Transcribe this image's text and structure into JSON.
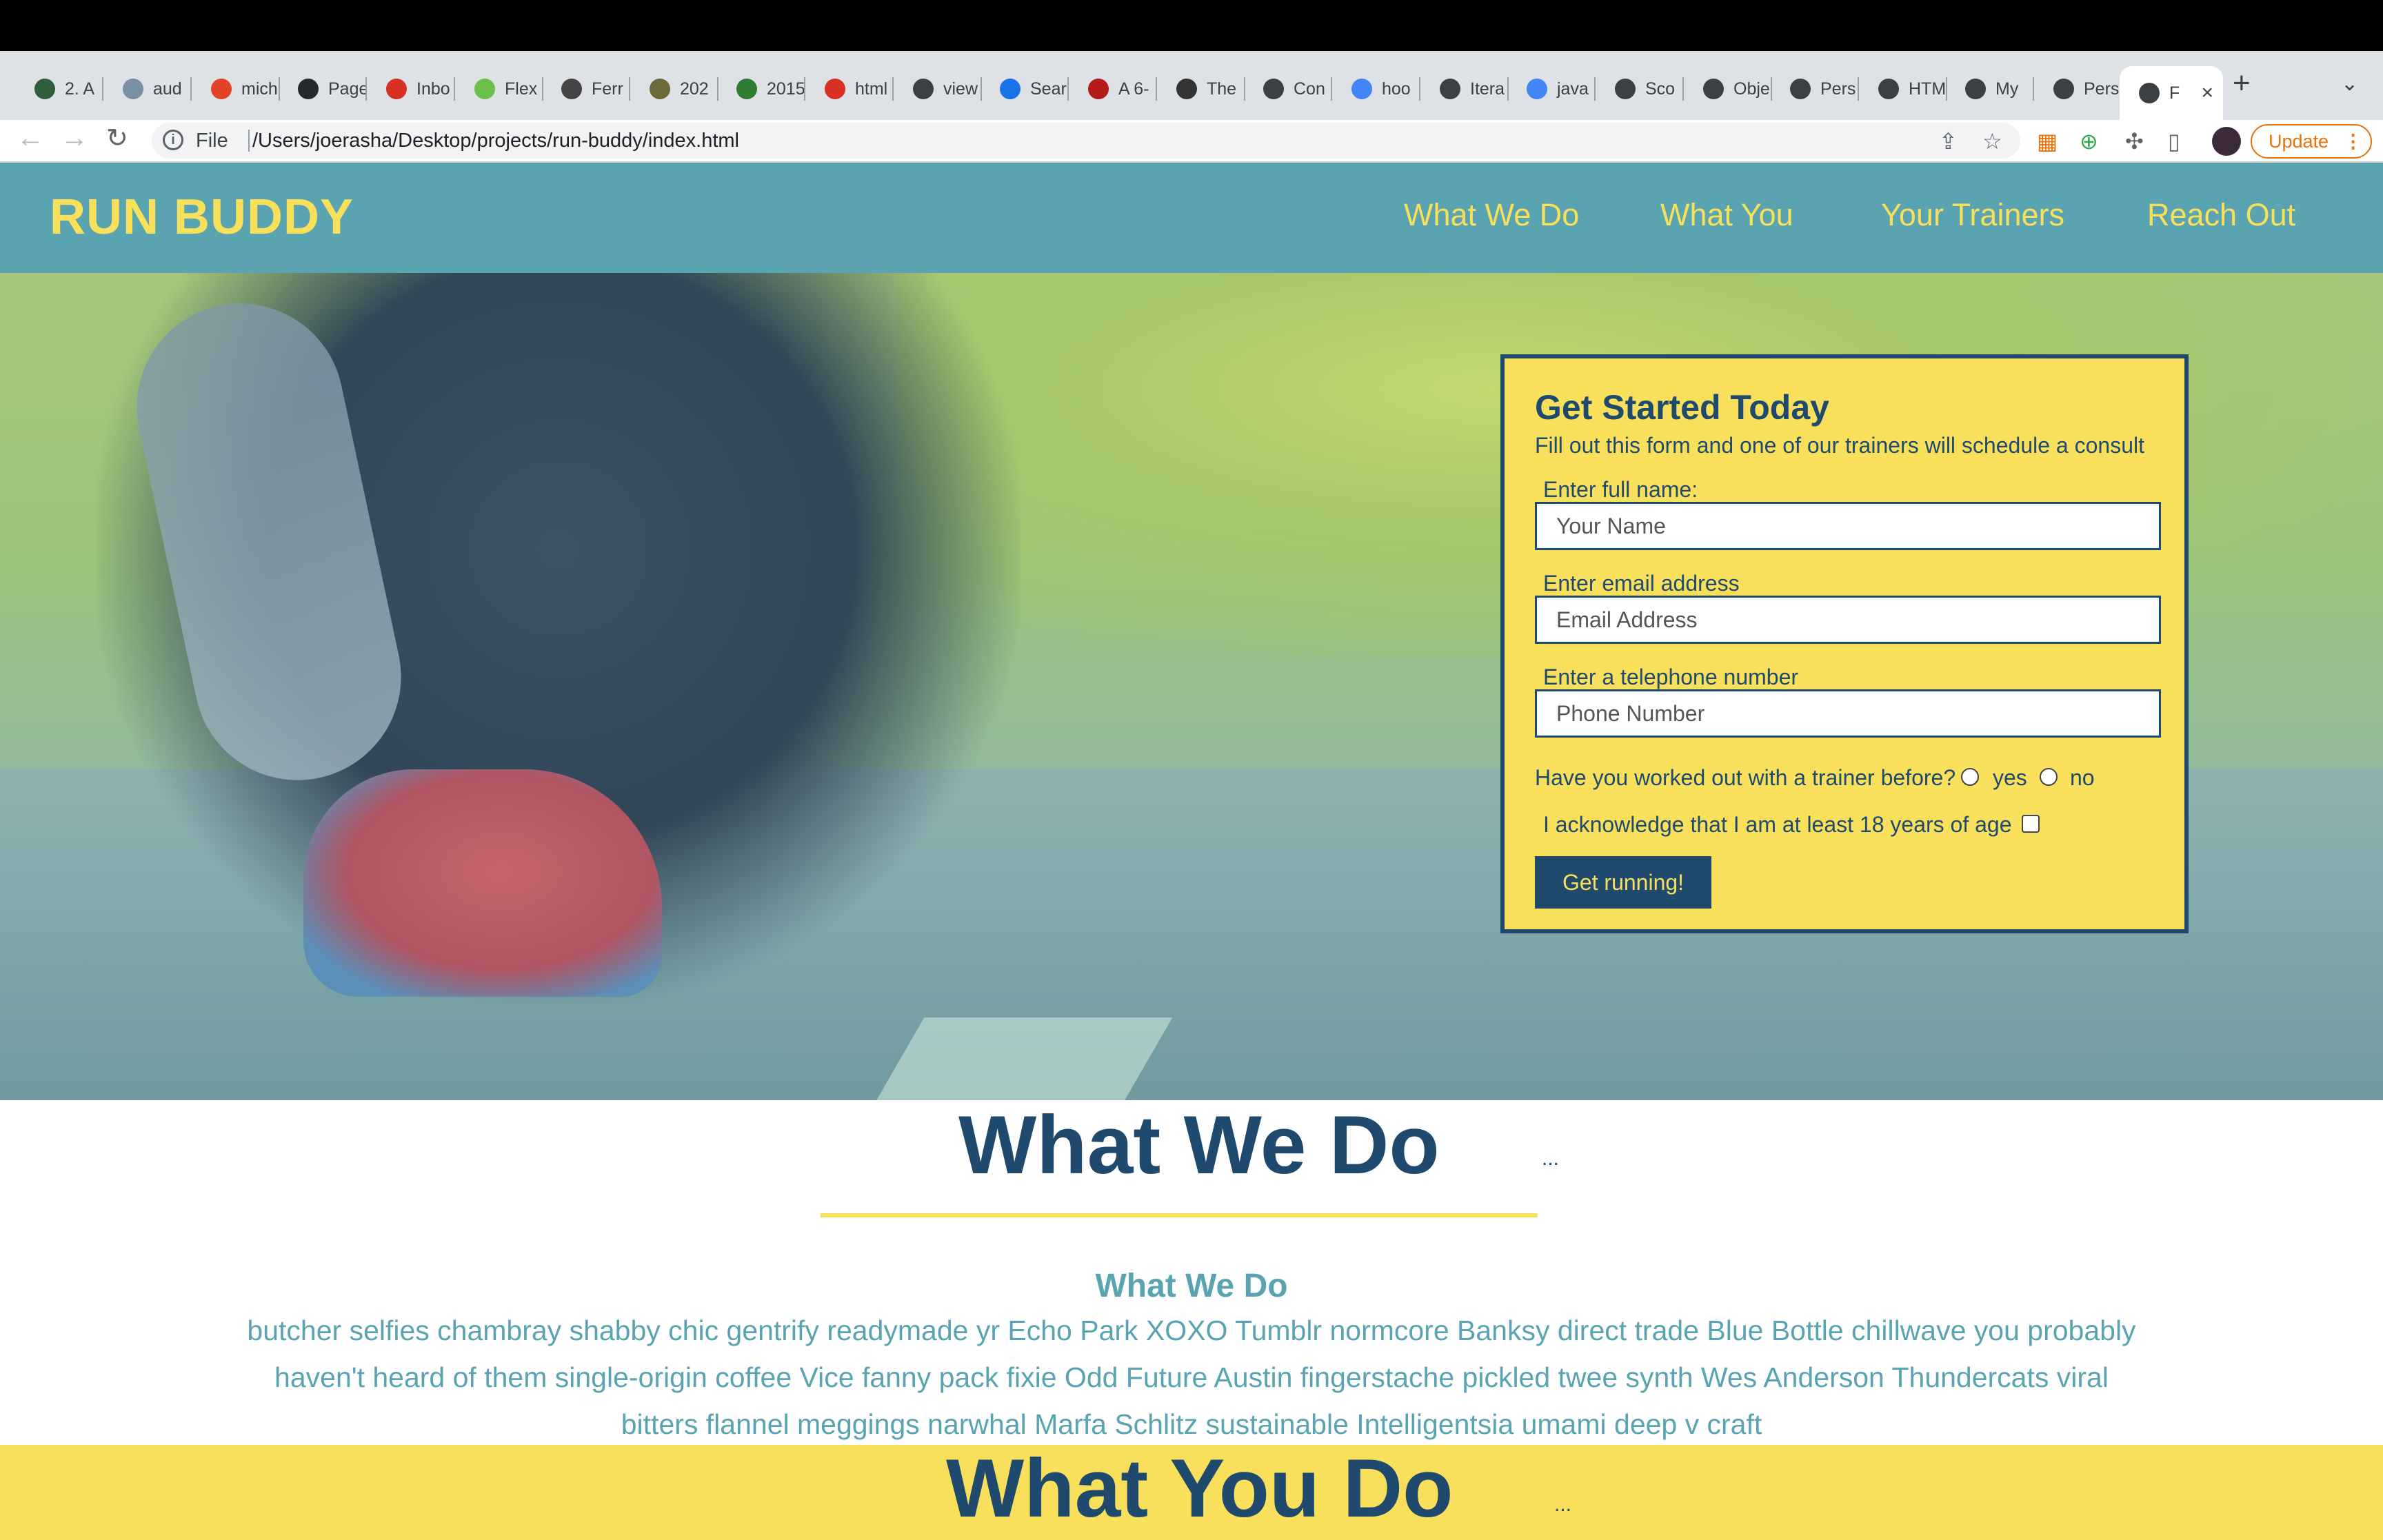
{
  "browser": {
    "tabs": [
      {
        "label": "2. A",
        "favicon": "spartan-icon",
        "color": "#2e5e3a"
      },
      {
        "label": "aud",
        "favicon": "w-icon",
        "color": "#7b8fa3"
      },
      {
        "label": "mich",
        "favicon": "gitlab-icon",
        "color": "#e24329"
      },
      {
        "label": "Page",
        "favicon": "github-icon",
        "color": "#24292e"
      },
      {
        "label": "Inbo",
        "favicon": "gmail-icon",
        "color": "#d93025"
      },
      {
        "label": "Flex",
        "favicon": "frog-icon",
        "color": "#6cbf4a"
      },
      {
        "label": "Ferr",
        "favicon": "person-icon",
        "color": "#444444"
      },
      {
        "label": "202",
        "favicon": "medal-icon",
        "color": "#6d6a3a"
      },
      {
        "label": "2015",
        "favicon": "numbers-icon",
        "color": "#2e7d32"
      },
      {
        "label": "html",
        "favicon": "gmail-icon",
        "color": "#d93025"
      },
      {
        "label": "view",
        "favicon": "globe-icon",
        "color": "#3c4043"
      },
      {
        "label": "Sear",
        "favicon": "chart-icon",
        "color": "#1a73e8"
      },
      {
        "label": "A 6-",
        "favicon": "ab-icon",
        "color": "#b71c1c"
      },
      {
        "label": "The",
        "favicon": "avatar-icon",
        "color": "#333333"
      },
      {
        "label": "Con",
        "favicon": "globe-icon",
        "color": "#3c4043"
      },
      {
        "label": "hoo",
        "favicon": "google-icon",
        "color": "#4285f4"
      },
      {
        "label": "Itera",
        "favicon": "globe-icon",
        "color": "#3c4043"
      },
      {
        "label": "java",
        "favicon": "google-icon",
        "color": "#4285f4"
      },
      {
        "label": "Sco",
        "favicon": "globe-icon",
        "color": "#3c4043"
      },
      {
        "label": "Obje",
        "favicon": "globe-icon",
        "color": "#3c4043"
      },
      {
        "label": "Pers",
        "favicon": "globe-icon",
        "color": "#3c4043"
      },
      {
        "label": "HTM",
        "favicon": "folder-icon",
        "color": "#3c4043"
      },
      {
        "label": "My",
        "favicon": "globe-icon",
        "color": "#3c4043"
      },
      {
        "label": "Pers",
        "favicon": "globe-icon",
        "color": "#3c4043"
      },
      {
        "label": "F",
        "favicon": "globe-icon",
        "color": "#3c4043",
        "active": true
      }
    ],
    "omnibox": {
      "scheme_label": "File",
      "url": "/Users/joerasha/Desktop/projects/run-buddy/index.html"
    },
    "update_label": "Update"
  },
  "site": {
    "logo": "RUN BUDDY",
    "nav": [
      "What We Do",
      "What You",
      "Your Trainers",
      "Reach Out"
    ],
    "colors": {
      "primary": "#5aa4b2",
      "accent": "#f8e05c",
      "dark": "#1f4a6e"
    }
  },
  "form": {
    "title": "Get Started Today",
    "subtitle": "Fill out this form and one of our trainers will schedule a consult",
    "name_label": "Enter full name:",
    "name_placeholder": "Your Name",
    "email_label": "Enter email address",
    "email_placeholder": "Email Address",
    "phone_label": "Enter a telephone number",
    "phone_placeholder": "Phone Number",
    "trainer_question": "Have you worked out with a trainer before?",
    "yes_label": "yes",
    "no_label": "no",
    "age_ack": "I acknowledge that I am at least 18 years of age",
    "submit_label": "Get running!"
  },
  "what_we_do": {
    "title": "What We Do",
    "dots": "...",
    "subtitle": "What We Do",
    "body": "butcher selfies chambray shabby chic gentrify readymade yr Echo Park XOXO Tumblr normcore Banksy direct trade Blue Bottle chillwave you probably haven't heard of them single-origin coffee Vice fanny pack fixie Odd Future Austin fingerstache pickled twee synth Wes Anderson Thundercats viral bitters flannel meggings narwhal Marfa Schlitz sustainable Intelligentsia umami deep v craft"
  },
  "what_you_do": {
    "title": "What You Do",
    "dots": "..."
  }
}
